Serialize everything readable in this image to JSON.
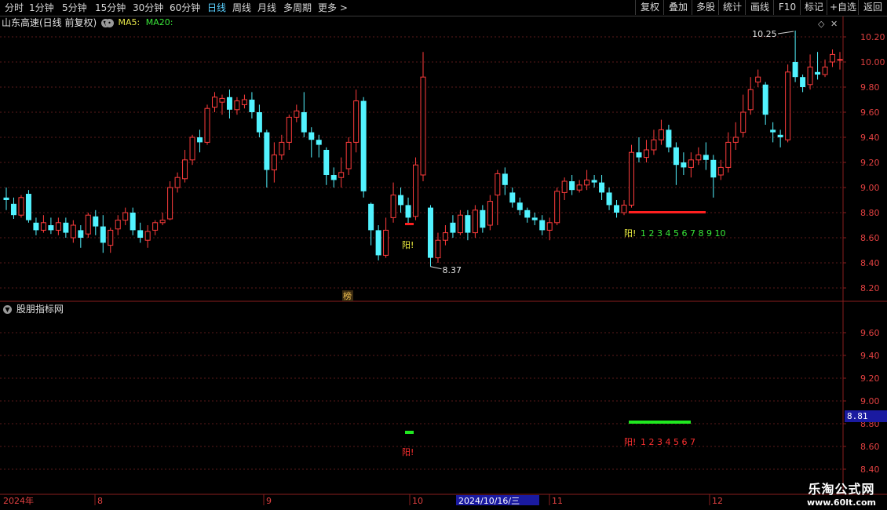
{
  "toolbar": {
    "periods": [
      "分时",
      "1分钟",
      "5分钟",
      "15分钟",
      "30分钟",
      "60分钟",
      "日线",
      "周线",
      "月线",
      "多周期",
      "更多 >"
    ],
    "active_period": "日线",
    "right_buttons": [
      "复权",
      "叠加",
      "多股",
      "统计",
      "画线",
      "F10",
      "标记",
      "+自选",
      "返回"
    ]
  },
  "main_panel": {
    "title": "山东高速(日线 前复权)",
    "ma5_label": "MA5:",
    "ma20_label": "MA20:",
    "ma5_color": "#e8e84a",
    "ma20_color": "#3ae83a",
    "y_ticks": [
      "10.20",
      "10.00",
      "9.80",
      "9.60",
      "9.40",
      "9.20",
      "9.00",
      "8.80",
      "8.60",
      "8.40",
      "8.20"
    ],
    "high_annotation": "10.25",
    "low_annotation": "8.37",
    "signal_label_1": "阳!",
    "signal_label_2": "阳!",
    "signal_count": "1 2 3 4 5 6 7 8 9 10",
    "rank_marker": "榜"
  },
  "indicator_panel": {
    "title": "股朋指标网",
    "y_ticks": [
      "9.60",
      "9.40",
      "9.20",
      "9.00",
      "8.80",
      "8.60",
      "8.40"
    ],
    "current_value": "8.81",
    "signal_label_1": "阳!",
    "signal_label_2": "阳!",
    "signal_count": "1 2 3 4 5 6 7"
  },
  "date_axis": {
    "year_label": "2024年",
    "months": [
      "8",
      "9",
      "10",
      "11",
      "12"
    ],
    "cursor_date": "2024/10/16/三"
  },
  "watermark": {
    "line1": "乐淘公式网",
    "line2": "www.60lt.com"
  },
  "colors": {
    "up": "#ff3c3c",
    "down": "#52f3ff",
    "grid": "#5a1a1a",
    "signal_red": "#ff2020",
    "signal_green": "#20e820",
    "axis_text": "#e04040"
  },
  "chart_data": {
    "type": "candlestick",
    "title": "山东高速(日线 前复权)",
    "ylim": [
      8.1,
      10.3
    ],
    "high": 10.25,
    "low": 8.37,
    "candles": [
      [
        8.92,
        8.9,
        9.0,
        8.82
      ],
      [
        8.87,
        8.78,
        8.92,
        8.75
      ],
      [
        8.78,
        8.92,
        8.94,
        8.76
      ],
      [
        8.95,
        8.74,
        8.98,
        8.72
      ],
      [
        8.72,
        8.66,
        8.76,
        8.62
      ],
      [
        8.66,
        8.72,
        8.78,
        8.64
      ],
      [
        8.7,
        8.66,
        8.76,
        8.63
      ],
      [
        8.66,
        8.72,
        8.76,
        8.62
      ],
      [
        8.72,
        8.64,
        8.76,
        8.6
      ],
      [
        8.6,
        8.7,
        8.74,
        8.56
      ],
      [
        8.66,
        8.6,
        8.7,
        8.52
      ],
      [
        8.63,
        8.78,
        8.8,
        8.6
      ],
      [
        8.77,
        8.69,
        8.82,
        8.62
      ],
      [
        8.69,
        8.56,
        8.78,
        8.48
      ],
      [
        8.54,
        8.66,
        8.68,
        8.48
      ],
      [
        8.67,
        8.74,
        8.78,
        8.62
      ],
      [
        8.74,
        8.8,
        8.84,
        8.7
      ],
      [
        8.8,
        8.66,
        8.84,
        8.62
      ],
      [
        8.66,
        8.6,
        8.72,
        8.56
      ],
      [
        8.58,
        8.65,
        8.7,
        8.52
      ],
      [
        8.66,
        8.72,
        8.74,
        8.62
      ],
      [
        8.72,
        8.74,
        8.8,
        8.7
      ],
      [
        8.75,
        9.0,
        9.05,
        8.74
      ],
      [
        9.0,
        9.08,
        9.12,
        8.96
      ],
      [
        9.07,
        9.22,
        9.3,
        9.04
      ],
      [
        9.22,
        9.4,
        9.42,
        9.18
      ],
      [
        9.4,
        9.36,
        9.46,
        9.28
      ],
      [
        9.36,
        9.63,
        9.66,
        9.34
      ],
      [
        9.64,
        9.72,
        9.76,
        9.6
      ],
      [
        9.68,
        9.71,
        9.74,
        9.58
      ],
      [
        9.72,
        9.62,
        9.78,
        9.55
      ],
      [
        9.62,
        9.69,
        9.72,
        9.58
      ],
      [
        9.66,
        9.7,
        9.74,
        9.63
      ],
      [
        9.7,
        9.6,
        9.76,
        9.55
      ],
      [
        9.6,
        9.44,
        9.66,
        9.4
      ],
      [
        9.44,
        9.14,
        9.46,
        9.0
      ],
      [
        9.14,
        9.26,
        9.36,
        9.04
      ],
      [
        9.26,
        9.36,
        9.42,
        9.22
      ],
      [
        9.36,
        9.56,
        9.58,
        9.3
      ],
      [
        9.56,
        9.61,
        9.66,
        9.52
      ],
      [
        9.6,
        9.44,
        9.76,
        9.4
      ],
      [
        9.44,
        9.38,
        9.48,
        9.24
      ],
      [
        9.38,
        9.34,
        9.42,
        9.24
      ],
      [
        9.3,
        9.1,
        9.32,
        9.02
      ],
      [
        9.1,
        9.06,
        9.16,
        9.0
      ],
      [
        9.08,
        9.12,
        9.24,
        9.0
      ],
      [
        9.15,
        9.36,
        9.4,
        9.1
      ],
      [
        9.36,
        9.69,
        9.78,
        9.28
      ],
      [
        9.69,
        8.97,
        9.72,
        8.92
      ],
      [
        8.87,
        8.66,
        8.88,
        8.54
      ],
      [
        8.66,
        8.46,
        8.7,
        8.42
      ],
      [
        8.46,
        8.66,
        8.76,
        8.44
      ],
      [
        8.76,
        8.94,
        9.04,
        8.72
      ],
      [
        8.94,
        8.86,
        9.0,
        8.8
      ],
      [
        8.86,
        8.76,
        8.92,
        8.7
      ],
      [
        8.77,
        9.18,
        9.24,
        8.74
      ],
      [
        9.1,
        9.88,
        10.08,
        9.05
      ],
      [
        8.84,
        8.44,
        8.86,
        8.37
      ],
      [
        8.44,
        8.58,
        8.64,
        8.4
      ],
      [
        8.58,
        8.64,
        8.7,
        8.54
      ],
      [
        8.72,
        8.64,
        8.78,
        8.6
      ],
      [
        8.64,
        8.78,
        8.82,
        8.62
      ],
      [
        8.78,
        8.64,
        8.82,
        8.58
      ],
      [
        8.64,
        8.82,
        8.86,
        8.6
      ],
      [
        8.82,
        8.68,
        8.86,
        8.64
      ],
      [
        8.7,
        8.89,
        8.94,
        8.66
      ],
      [
        8.94,
        9.11,
        9.14,
        8.7
      ],
      [
        9.11,
        9.02,
        9.16,
        8.94
      ],
      [
        8.96,
        8.88,
        9.0,
        8.84
      ],
      [
        8.88,
        8.82,
        8.92,
        8.78
      ],
      [
        8.82,
        8.76,
        8.84,
        8.72
      ],
      [
        8.76,
        8.74,
        8.8,
        8.7
      ],
      [
        8.74,
        8.66,
        8.78,
        8.62
      ],
      [
        8.66,
        8.72,
        8.76,
        8.58
      ],
      [
        8.72,
        8.97,
        9.0,
        8.7
      ],
      [
        8.96,
        9.05,
        9.08,
        8.9
      ],
      [
        9.05,
        8.98,
        9.1,
        8.94
      ],
      [
        8.98,
        9.02,
        9.06,
        8.96
      ],
      [
        9.02,
        9.06,
        9.14,
        8.98
      ],
      [
        9.06,
        9.04,
        9.1,
        9.0
      ],
      [
        9.04,
        8.96,
        9.1,
        8.9
      ],
      [
        8.96,
        8.86,
        9.0,
        8.82
      ],
      [
        8.86,
        8.8,
        8.9,
        8.76
      ],
      [
        8.8,
        8.86,
        8.9,
        8.78
      ],
      [
        8.86,
        9.28,
        9.34,
        8.84
      ],
      [
        9.28,
        9.24,
        9.4,
        9.2
      ],
      [
        9.24,
        9.3,
        9.38,
        9.2
      ],
      [
        9.3,
        9.38,
        9.46,
        9.26
      ],
      [
        9.38,
        9.46,
        9.54,
        9.34
      ],
      [
        9.46,
        9.32,
        9.5,
        9.28
      ],
      [
        9.32,
        9.18,
        9.36,
        9.02
      ],
      [
        9.2,
        9.16,
        9.28,
        9.1
      ],
      [
        9.16,
        9.22,
        9.28,
        9.08
      ],
      [
        9.22,
        9.26,
        9.32,
        9.18
      ],
      [
        9.26,
        9.22,
        9.36,
        9.14
      ],
      [
        9.22,
        9.08,
        9.26,
        8.92
      ],
      [
        9.1,
        9.16,
        9.22,
        9.06
      ],
      [
        9.16,
        9.36,
        9.44,
        9.12
      ],
      [
        9.36,
        9.4,
        9.52,
        9.3
      ],
      [
        9.44,
        9.6,
        9.74,
        9.4
      ],
      [
        9.62,
        9.78,
        9.88,
        9.58
      ],
      [
        9.84,
        9.88,
        9.94,
        9.8
      ],
      [
        9.82,
        9.58,
        9.84,
        9.5
      ],
      [
        9.46,
        9.44,
        9.52,
        9.36
      ],
      [
        9.42,
        9.4,
        9.46,
        9.32
      ],
      [
        9.38,
        9.92,
        9.98,
        9.36
      ],
      [
        10.0,
        9.88,
        10.25,
        9.84
      ],
      [
        9.88,
        9.8,
        9.9,
        9.76
      ],
      [
        9.82,
        9.96,
        10.06,
        9.78
      ],
      [
        9.92,
        9.9,
        10.08,
        9.86
      ],
      [
        9.9,
        9.96,
        10.02,
        9.88
      ],
      [
        10.0,
        10.06,
        10.1,
        9.96
      ],
      [
        10.02,
        10.02,
        10.08,
        9.94
      ]
    ],
    "indicator": {
      "ylim": [
        8.33,
        9.78
      ],
      "current": 8.81
    }
  }
}
